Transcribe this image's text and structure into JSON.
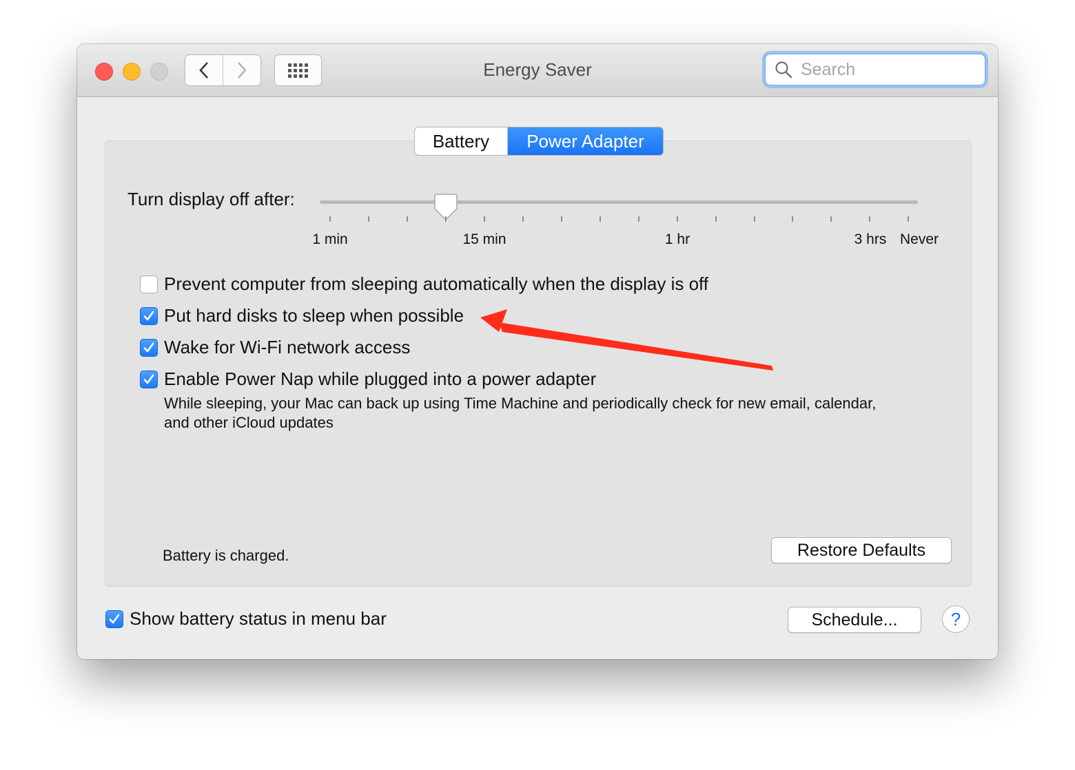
{
  "window": {
    "title": "Energy Saver"
  },
  "toolbar": {
    "back_icon": "chevron-left-icon",
    "forward_icon": "chevron-right-icon",
    "grid_icon": "show-all-grid-icon"
  },
  "search": {
    "placeholder": "Search",
    "value": ""
  },
  "tabs": [
    {
      "label": "Battery",
      "selected": false
    },
    {
      "label": "Power Adapter",
      "selected": true
    }
  ],
  "display_sleep": {
    "label": "Turn display off after:",
    "value": "10 min",
    "tick_labels": [
      "1 min",
      "15 min",
      "1 hr",
      "3 hrs",
      "Never"
    ]
  },
  "options": [
    {
      "label": "Prevent computer from sleeping automatically when the display is off",
      "checked": false
    },
    {
      "label": "Put hard disks to sleep when possible",
      "checked": true
    },
    {
      "label": "Wake for Wi-Fi network access",
      "checked": true
    },
    {
      "label": "Enable Power Nap while plugged into a power adapter",
      "checked": true
    }
  ],
  "power_nap_description": "While sleeping, your Mac can back up using Time Machine and periodically check for new email, calendar, and other iCloud updates",
  "status": "Battery is charged.",
  "buttons": {
    "restore_defaults": "Restore Defaults",
    "schedule": "Schedule...",
    "help": "?"
  },
  "menu_bar_option": {
    "label": "Show battery status in menu bar",
    "checked": true
  },
  "colors": {
    "accent": "#1a74f5",
    "close": "#fc5b57",
    "minimize": "#fdbb2d",
    "annotation_arrow": "#ff2d1a"
  }
}
